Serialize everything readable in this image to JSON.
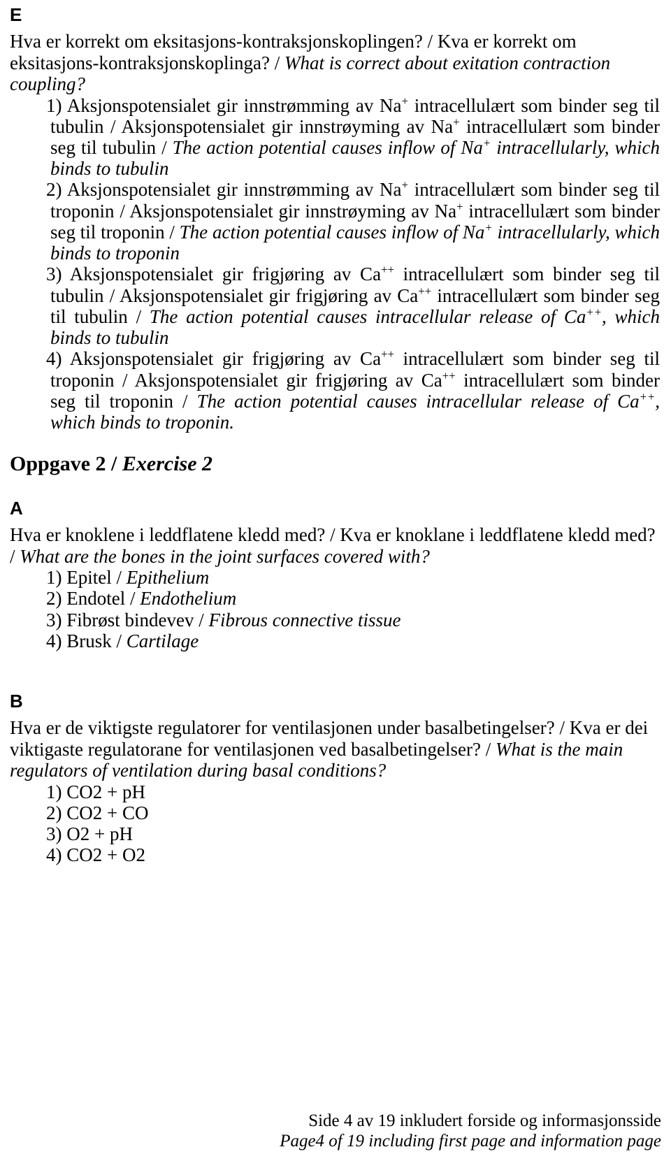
{
  "document": {
    "language_note": "Bokmål / Nynorsk / English trilingual exam paper"
  },
  "sections": [
    {
      "letter": "E",
      "question": {
        "bokmal": "Hva er korrekt om eksitasjons-kontraksjonskoplingen?",
        "nynorsk": "Kva er korrekt om eksitasjons-kontraksjonskoplinga?",
        "english": "What is correct about exitation contraction coupling?"
      },
      "answers": [
        {
          "number": "1)",
          "bokmal_pre": "Aksjonspotensialet gir innstrømming av Na",
          "bokmal_sup": "+",
          "bokmal_post": " intracellulært som binder seg til tubulin /",
          "nynorsk_pre": " Aksjonspotensialet gir innstrøyming av Na",
          "nynorsk_sup": "+",
          "nynorsk_post": " intracellulært som binder seg til tubulin /",
          "english_pre": " The action potential causes inflow of Na",
          "english_sup": "+",
          "english_post": " intracellularly, which binds to tubulin"
        },
        {
          "number": "2)",
          "bokmal_pre": "Aksjonspotensialet gir innstrømming av Na",
          "bokmal_sup": "+",
          "bokmal_post": " intracellulært som binder seg til troponin /",
          "nynorsk_pre": " Aksjonspotensialet gir innstrøyming av Na",
          "nynorsk_sup": "+",
          "nynorsk_post": " intracellulært som binder seg til troponin /",
          "english_pre": " The action potential causes inflow of Na",
          "english_sup": "+",
          "english_post": " intracellularly, which binds to troponin"
        },
        {
          "number": "3)",
          "bokmal_pre": "Aksjonspotensialet gir frigjøring av Ca",
          "bokmal_sup": "++",
          "bokmal_post": " intracellulært som binder seg til tubulin /",
          "nynorsk_pre": " Aksjonspotensialet gir frigjøring av Ca",
          "nynorsk_sup": "++",
          "nynorsk_post": " intracellulært som binder seg til tubulin /",
          "english_pre": " The action potential causes intracellular release of Ca",
          "english_sup": "++",
          "english_post": ", which binds to tubulin"
        },
        {
          "number": "4)",
          "bokmal_pre": "Aksjonspotensialet gir frigjøring av Ca",
          "bokmal_sup": "++",
          "bokmal_post": " intracellulært som binder seg til troponin /",
          "nynorsk_pre": " Aksjonspotensialet gir frigjøring av Ca",
          "nynorsk_sup": "++",
          "nynorsk_post": " intracellulært som binder seg til troponin /",
          "english_pre": " The action potential causes intracellular release of Ca",
          "english_sup": "++",
          "english_post": ", which binds to troponin."
        }
      ]
    }
  ],
  "exercise2": {
    "heading_no": "Oppgave 2",
    "heading_sep": " / ",
    "heading_en": "Exercise 2",
    "sectionA": {
      "letter": "A",
      "question": {
        "bokmal": "Hva er knoklene i leddflatene kledd med?",
        "nynorsk": "Kva er knoklane i leddflatene kledd med?",
        "english": "What are the bones in the joint surfaces covered with?"
      },
      "answers": [
        {
          "number": "1)",
          "no": "Epitel",
          "sep": " / ",
          "en": "Epithelium"
        },
        {
          "number": "2)",
          "no": "Endotel",
          "sep": " / ",
          "en": "Endothelium"
        },
        {
          "number": "3)",
          "no": "Fibrøst bindevev",
          "sep": " / ",
          "en": "Fibrous connective tissue"
        },
        {
          "number": "4)",
          "no": "Brusk",
          "sep": " / ",
          "en": "Cartilage"
        }
      ]
    },
    "sectionB": {
      "letter": "B",
      "question": {
        "bokmal": "Hva er de viktigste regulatorer for ventilasjonen under basalbetingelser?",
        "nynorsk": "Kva er dei viktigaste regulatorane for ventilasjonen ved basalbetingelser?",
        "english": "What is the main regulators of ventilation during basal conditions?"
      },
      "answers": [
        {
          "number": "1)",
          "text": "CO2 + pH"
        },
        {
          "number": "2)",
          "text": "CO2 + CO"
        },
        {
          "number": "3)",
          "text": "O2 + pH"
        },
        {
          "number": "4)",
          "text": "CO2 + O2"
        }
      ]
    }
  },
  "footer": {
    "line_no": "Side 4 av 19 inkludert forside og informasjonsside",
    "line_en": "Page4 of 19 including first page and information page"
  }
}
